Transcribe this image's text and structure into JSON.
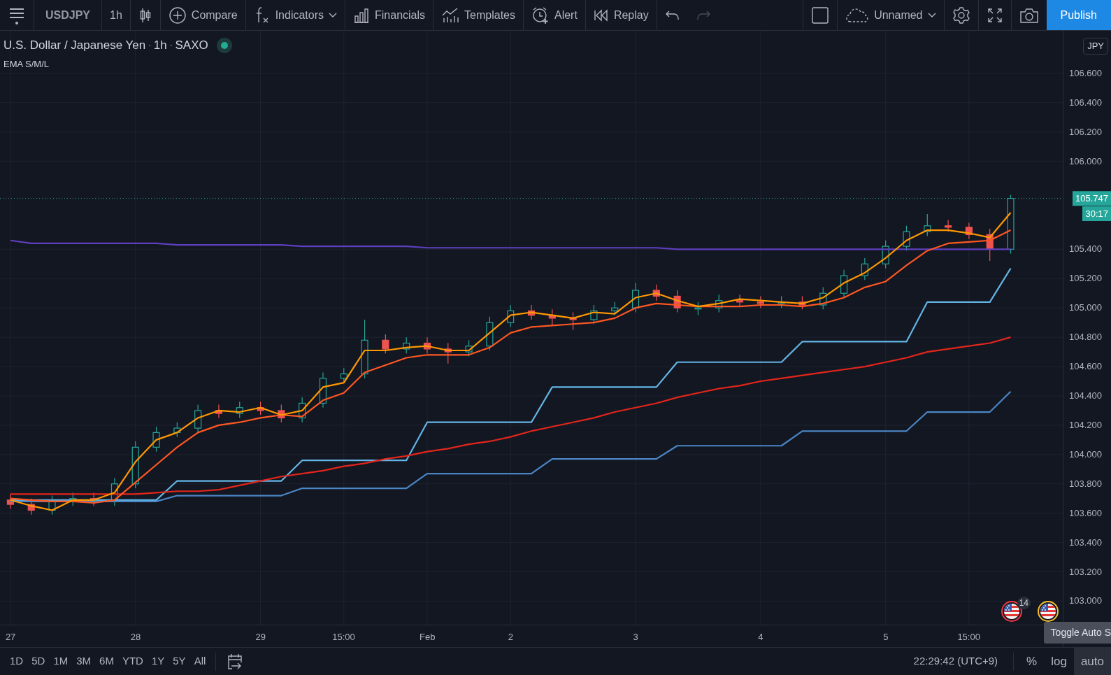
{
  "toolbar": {
    "items": [
      {
        "kind": "menu",
        "disabled": false
      },
      {
        "kind": "symbol",
        "label": "USDJPY",
        "disabled": false
      },
      {
        "kind": "interval",
        "label": "1h",
        "disabled": false
      },
      {
        "kind": "chart_type",
        "disabled": false
      },
      {
        "kind": "compare",
        "label": "Compare",
        "disabled": false
      },
      {
        "kind": "indicators",
        "label": "Indicators",
        "disabled": false
      },
      {
        "kind": "financials",
        "label": "Financials",
        "disabled": false
      },
      {
        "kind": "templates",
        "label": "Templates",
        "disabled": false
      },
      {
        "kind": "alert",
        "label": "Alert",
        "disabled": false
      },
      {
        "kind": "replay",
        "label": "Replay",
        "disabled": false
      },
      {
        "kind": "undo",
        "disabled": false
      },
      {
        "kind": "redo",
        "disabled": true
      },
      {
        "kind": "layout",
        "disabled": false
      },
      {
        "kind": "save",
        "label": "Unnamed",
        "disabled": false
      },
      {
        "kind": "settings",
        "disabled": false
      },
      {
        "kind": "fullscreen",
        "disabled": false
      },
      {
        "kind": "snapshot",
        "disabled": false
      },
      {
        "kind": "publish",
        "label": "Publish",
        "disabled": false
      }
    ]
  },
  "legend": {
    "parts": [
      "U.S. Dollar / Japanese Yen",
      "1h",
      "SAXO"
    ],
    "separator": "·",
    "market_open": true,
    "indicator": "EMA S/M/L"
  },
  "chart": {
    "currency": "JPY",
    "countdown": "30:17",
    "events": [
      {
        "color": "#f23645",
        "count": "14"
      },
      {
        "color": "#f9c02b"
      }
    ],
    "chart_data": {
      "type": "candlestick",
      "ylim": [
        102.84,
        106.89
      ],
      "grid": true,
      "ref_lines": [
        {
          "axis": "y",
          "value": 105.747,
          "label": "105.747",
          "color": "#26a69a"
        }
      ],
      "categories": [
        "27",
        null,
        null,
        null,
        null,
        null,
        "28",
        null,
        null,
        null,
        null,
        null,
        "29",
        null,
        null,
        null,
        "15:00",
        null,
        null,
        null,
        "Feb",
        null,
        null,
        null,
        "2",
        null,
        null,
        null,
        null,
        null,
        "3",
        null,
        null,
        null,
        null,
        null,
        "4",
        null,
        null,
        null,
        null,
        null,
        "5",
        null,
        null,
        null,
        "15:00",
        null,
        null,
        null,
        null
      ],
      "yticks": [
        {
          "value": 103.0,
          "label": "103.000"
        },
        {
          "value": 103.2,
          "label": "103.200"
        },
        {
          "value": 103.4,
          "label": "103.400"
        },
        {
          "value": 103.6,
          "label": "103.600"
        },
        {
          "value": 103.8,
          "label": "103.800"
        },
        {
          "value": 104.0,
          "label": "104.000"
        },
        {
          "value": 104.2,
          "label": "104.200"
        },
        {
          "value": 104.4,
          "label": "104.400"
        },
        {
          "value": 104.6,
          "label": "104.600"
        },
        {
          "value": 104.8,
          "label": "104.800"
        },
        {
          "value": 105.0,
          "label": "105.000"
        },
        {
          "value": 105.2,
          "label": "105.200"
        },
        {
          "value": 105.4,
          "label": "105.400"
        },
        {
          "value": 106.0,
          "label": "106.000"
        },
        {
          "value": 106.2,
          "label": "106.200"
        },
        {
          "value": 106.4,
          "label": "106.400"
        },
        {
          "value": 106.6,
          "label": "106.600"
        }
      ],
      "ohlc": [
        [
          103.69,
          103.73,
          103.63,
          103.66
        ],
        [
          103.66,
          103.7,
          103.59,
          103.62
        ],
        [
          103.62,
          103.72,
          103.59,
          103.68
        ],
        [
          103.68,
          103.74,
          103.65,
          103.7
        ],
        [
          103.7,
          103.74,
          103.65,
          103.68
        ],
        [
          103.68,
          103.84,
          103.65,
          103.8
        ],
        [
          103.8,
          104.09,
          103.77,
          104.05
        ],
        [
          104.05,
          104.19,
          104.02,
          104.15
        ],
        [
          104.15,
          104.22,
          104.12,
          104.18
        ],
        [
          104.18,
          104.34,
          104.15,
          104.3
        ],
        [
          104.3,
          104.34,
          104.25,
          104.28
        ],
        [
          104.28,
          104.36,
          104.25,
          104.32
        ],
        [
          104.32,
          104.36,
          104.27,
          104.3
        ],
        [
          104.3,
          104.34,
          104.22,
          104.25
        ],
        [
          104.25,
          104.39,
          104.22,
          104.35
        ],
        [
          104.35,
          104.56,
          104.32,
          104.52
        ],
        [
          104.52,
          104.59,
          104.49,
          104.55
        ],
        [
          104.55,
          104.92,
          104.52,
          104.78
        ],
        [
          104.78,
          104.82,
          104.69,
          104.72
        ],
        [
          104.72,
          104.8,
          104.69,
          104.76
        ],
        [
          104.76,
          104.8,
          104.69,
          104.72
        ],
        [
          104.72,
          104.76,
          104.62,
          104.7
        ],
        [
          104.7,
          104.78,
          104.67,
          104.74
        ],
        [
          104.74,
          104.94,
          104.71,
          104.9
        ],
        [
          104.9,
          105.02,
          104.87,
          104.98
        ],
        [
          104.98,
          105.02,
          104.92,
          104.95
        ],
        [
          104.95,
          104.99,
          104.88,
          104.93
        ],
        [
          104.93,
          104.97,
          104.85,
          104.92
        ],
        [
          104.92,
          105.02,
          104.89,
          104.98
        ],
        [
          104.98,
          105.04,
          104.95,
          105.0
        ],
        [
          105.0,
          105.17,
          104.97,
          105.12
        ],
        [
          105.12,
          105.16,
          105.05,
          105.08
        ],
        [
          105.08,
          105.12,
          104.97,
          105.0
        ],
        [
          105.0,
          105.04,
          104.95,
          105.0
        ],
        [
          105.0,
          105.09,
          104.97,
          105.05
        ],
        [
          105.05,
          105.09,
          105.01,
          105.04
        ],
        [
          105.04,
          105.08,
          105.0,
          105.03
        ],
        [
          105.03,
          105.08,
          105.0,
          105.04
        ],
        [
          105.04,
          105.08,
          104.99,
          105.02
        ],
        [
          105.02,
          105.14,
          104.99,
          105.1
        ],
        [
          105.1,
          105.26,
          105.07,
          105.22
        ],
        [
          105.22,
          105.34,
          105.19,
          105.3
        ],
        [
          105.3,
          105.46,
          105.27,
          105.42
        ],
        [
          105.42,
          105.56,
          105.39,
          105.52
        ],
        [
          105.52,
          105.64,
          105.49,
          105.56
        ],
        [
          105.56,
          105.6,
          105.52,
          105.55
        ],
        [
          105.55,
          105.58,
          105.47,
          105.5
        ],
        [
          105.5,
          105.54,
          105.32,
          105.4
        ],
        [
          105.4,
          105.77,
          105.37,
          105.747
        ],
        null,
        null
      ],
      "series": [
        {
          "type": "line",
          "color": "#64b5e6",
          "values": [
            103.69,
            103.69,
            103.69,
            103.69,
            103.69,
            103.69,
            103.69,
            103.69,
            103.82,
            103.82,
            103.82,
            103.82,
            103.82,
            103.82,
            103.96,
            103.96,
            103.96,
            103.96,
            103.96,
            103.96,
            104.22,
            104.22,
            104.22,
            104.22,
            104.22,
            104.22,
            104.46,
            104.46,
            104.46,
            104.46,
            104.46,
            104.46,
            104.63,
            104.63,
            104.63,
            104.63,
            104.63,
            104.63,
            104.77,
            104.77,
            104.77,
            104.77,
            104.77,
            104.77,
            105.04,
            105.04,
            105.04,
            105.04,
            105.27,
            null,
            null
          ]
        },
        {
          "type": "line",
          "color": "#4a86c5",
          "values": [
            103.68,
            103.68,
            103.68,
            103.68,
            103.68,
            103.68,
            103.68,
            103.68,
            103.72,
            103.72,
            103.72,
            103.72,
            103.72,
            103.72,
            103.77,
            103.77,
            103.77,
            103.77,
            103.77,
            103.77,
            103.87,
            103.87,
            103.87,
            103.87,
            103.87,
            103.87,
            103.97,
            103.97,
            103.97,
            103.97,
            103.97,
            103.97,
            104.06,
            104.06,
            104.06,
            104.06,
            104.06,
            104.06,
            104.16,
            104.16,
            104.16,
            104.16,
            104.16,
            104.16,
            104.29,
            104.29,
            104.29,
            104.29,
            104.43,
            null,
            null
          ]
        },
        {
          "type": "line",
          "color": "#5e3fbe",
          "values": [
            105.46,
            105.44,
            105.44,
            105.44,
            105.44,
            105.44,
            105.44,
            105.44,
            105.43,
            105.43,
            105.43,
            105.43,
            105.43,
            105.43,
            105.42,
            105.42,
            105.42,
            105.42,
            105.42,
            105.42,
            105.41,
            105.41,
            105.41,
            105.41,
            105.41,
            105.41,
            105.41,
            105.41,
            105.41,
            105.41,
            105.41,
            105.41,
            105.4,
            105.4,
            105.4,
            105.4,
            105.4,
            105.4,
            105.4,
            105.4,
            105.4,
            105.4,
            105.4,
            105.4,
            105.4,
            105.4,
            105.4,
            105.4,
            105.4,
            null,
            null
          ]
        },
        {
          "type": "line",
          "color": "#e3251b",
          "values": [
            103.73,
            103.73,
            103.73,
            103.73,
            103.73,
            103.73,
            103.73,
            103.74,
            103.75,
            103.75,
            103.76,
            103.79,
            103.82,
            103.85,
            103.87,
            103.89,
            103.92,
            103.94,
            103.97,
            103.99,
            104.02,
            104.04,
            104.07,
            104.09,
            104.12,
            104.16,
            104.19,
            104.22,
            104.25,
            104.29,
            104.32,
            104.35,
            104.39,
            104.42,
            104.45,
            104.47,
            104.5,
            104.52,
            104.54,
            104.56,
            104.58,
            104.6,
            104.63,
            104.66,
            104.7,
            104.72,
            104.74,
            104.76,
            104.8,
            null,
            null
          ]
        },
        {
          "type": "line",
          "color": "#ff5722",
          "values": [
            103.7,
            103.69,
            103.68,
            103.68,
            103.67,
            103.69,
            103.81,
            103.93,
            104.05,
            104.15,
            104.2,
            104.22,
            104.25,
            104.27,
            104.26,
            104.37,
            104.42,
            104.56,
            104.61,
            104.66,
            104.68,
            104.68,
            104.68,
            104.73,
            104.83,
            104.87,
            104.88,
            104.89,
            104.9,
            104.93,
            105.0,
            105.03,
            105.02,
            105.01,
            105.01,
            105.01,
            105.02,
            105.02,
            105.01,
            105.03,
            105.07,
            105.14,
            105.18,
            105.29,
            105.39,
            105.44,
            105.45,
            105.46,
            105.53,
            null,
            null
          ]
        },
        {
          "type": "line",
          "color": "#ff9800",
          "values": [
            103.69,
            103.65,
            103.62,
            103.69,
            103.69,
            103.74,
            103.95,
            104.1,
            104.15,
            104.25,
            104.3,
            104.29,
            104.32,
            104.27,
            104.3,
            104.46,
            104.49,
            104.71,
            104.71,
            104.73,
            104.74,
            104.71,
            104.71,
            104.83,
            104.95,
            104.97,
            104.95,
            104.93,
            104.97,
            104.96,
            105.07,
            105.1,
            105.05,
            105.01,
            105.03,
            105.06,
            105.05,
            105.04,
            105.03,
            105.07,
            105.17,
            105.24,
            105.34,
            105.46,
            105.53,
            105.53,
            105.51,
            105.48,
            105.65,
            null,
            null
          ]
        }
      ]
    }
  },
  "tooltip": "Toggle Auto S",
  "bottom_bar": {
    "ranges": [
      {
        "label": "1D",
        "selected": false
      },
      {
        "label": "5D",
        "selected": false
      },
      {
        "label": "1M",
        "selected": false
      },
      {
        "label": "3M",
        "selected": false
      },
      {
        "label": "6M",
        "selected": false
      },
      {
        "label": "YTD",
        "selected": false
      },
      {
        "label": "1Y",
        "selected": false
      },
      {
        "label": "5Y",
        "selected": false
      },
      {
        "label": "All",
        "selected": false
      }
    ],
    "time": "22:29:42 (UTC+9)",
    "scales": [
      {
        "label": "%",
        "selected": false
      },
      {
        "label": "log",
        "selected": false
      },
      {
        "label": "auto",
        "selected": true
      }
    ]
  }
}
